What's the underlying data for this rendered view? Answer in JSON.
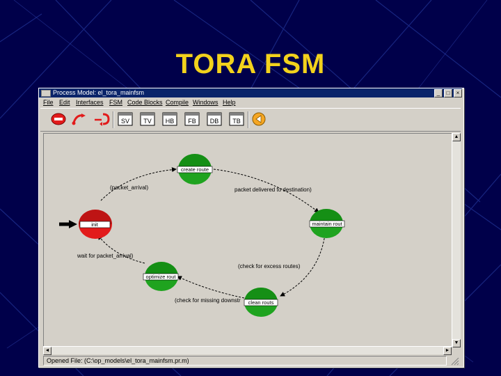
{
  "slide": {
    "title": "TORA FSM"
  },
  "window": {
    "title": "Process Model: el_tora_mainfsm",
    "controls": {
      "minimize": "_",
      "maximize": "□",
      "close": "×"
    }
  },
  "menu": {
    "items": [
      {
        "label": "File"
      },
      {
        "label": "Edit"
      },
      {
        "label": "Interfaces"
      },
      {
        "label": "FSM"
      },
      {
        "label": "Code Blocks"
      },
      {
        "label": "Compile"
      },
      {
        "label": "Windows"
      },
      {
        "label": "Help"
      }
    ]
  },
  "toolbar": {
    "buttons": [
      {
        "icon": "create-state-icon"
      },
      {
        "icon": "create-transition-icon"
      },
      {
        "icon": "create-self-transition-icon"
      },
      {
        "icon": "edit-state-variables-icon"
      },
      {
        "icon": "edit-temporary-variables-icon"
      },
      {
        "icon": "edit-header-block-icon"
      },
      {
        "icon": "edit-function-block-icon"
      },
      {
        "icon": "edit-diagnostic-block-icon"
      },
      {
        "icon": "edit-termination-block-icon"
      },
      {
        "icon": "compile-icon"
      }
    ]
  },
  "fsm": {
    "states": [
      {
        "id": "create",
        "label": "create route",
        "color": "#1fa31f",
        "initial": false
      },
      {
        "id": "init",
        "label": "init",
        "color": "#e21b1b",
        "initial": true
      },
      {
        "id": "maintain",
        "label": "maintain rout",
        "color": "#1fa31f",
        "initial": false
      },
      {
        "id": "optimize",
        "label": "optimize rout",
        "color": "#1fa31f",
        "initial": false
      },
      {
        "id": "clean",
        "label": "clean routs",
        "color": "#1fa31f",
        "initial": false
      }
    ],
    "transitions": [
      {
        "from": "init",
        "to": "create",
        "label": "(packet_arrival)"
      },
      {
        "from": "create",
        "to": "maintain",
        "label": "packet delivered to destination)"
      },
      {
        "from": "maintain",
        "to": "clean",
        "label": "(check for excess routes)"
      },
      {
        "from": "clean",
        "to": "optimize",
        "label": "(check for missing downstr"
      },
      {
        "from": "optimize",
        "to": "init",
        "label": "wait for packet_arrival)"
      }
    ]
  },
  "status": {
    "text": "Opened File: (C:\\op_models\\el_tora_mainfsm.pr.m)"
  },
  "colors": {
    "slide_background": "#00004a",
    "title": "#f2d21c",
    "window_titlebar": "#0a246a",
    "state_forced": "#1fa31f",
    "state_initial": "#e21b1b"
  }
}
